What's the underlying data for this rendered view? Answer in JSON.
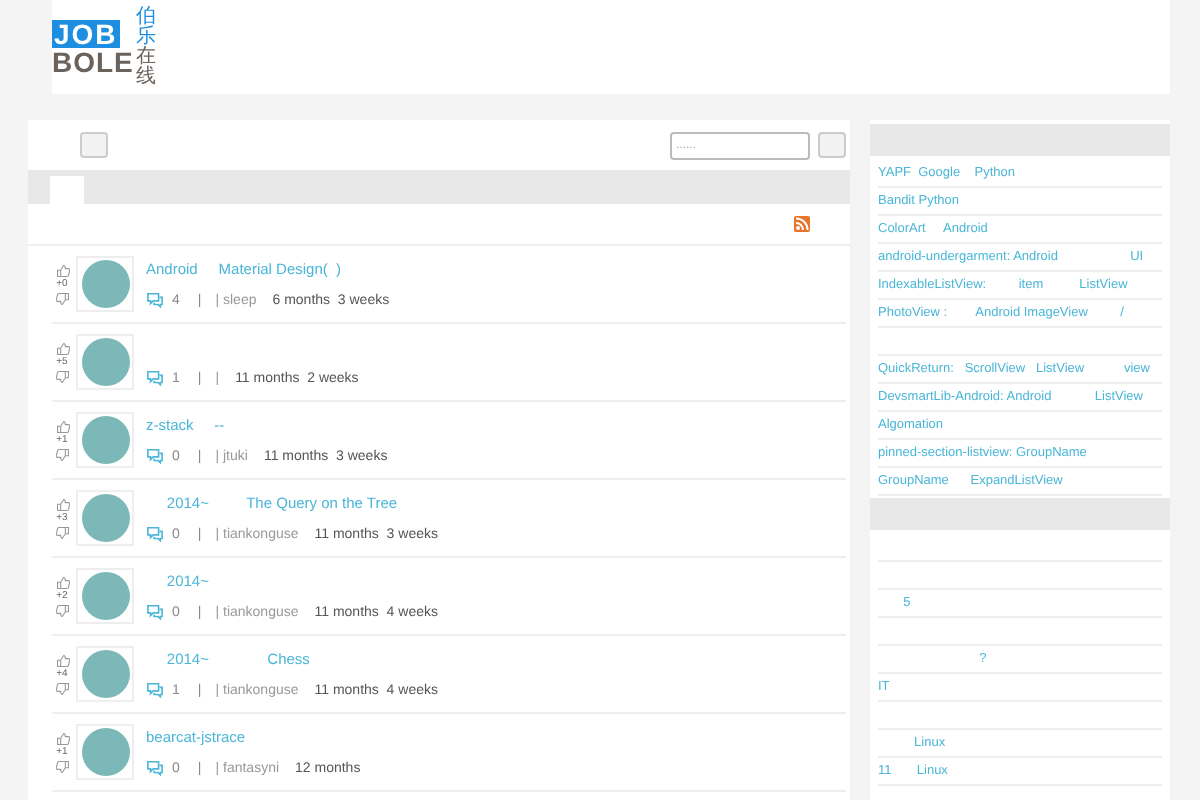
{
  "logo": {
    "top": "JOB",
    "bottom": "BOLE",
    "cjk_top": "伯乐",
    "cjk_bottom": "在线"
  },
  "search": {
    "placeholder": "......"
  },
  "tabs": [
    {
      "selected": true
    }
  ],
  "posts": [
    {
      "score": "+0",
      "title": "Android     Material Design(  )",
      "comments": "4",
      "separator": "|",
      "author": "| sleep",
      "time": "6 months  3 weeks"
    },
    {
      "score": "+5",
      "comments": "1",
      "separator": "|",
      "author": "|",
      "time": "11 months  2 weeks"
    },
    {
      "score": "+1",
      "title": "z-stack     --",
      "comments": "0",
      "separator": "|",
      "author": "| jtuki",
      "time": "11 months  3 weeks"
    },
    {
      "score": "+3",
      "title": "     2014~         The Query on the Tree",
      "comments": "0",
      "separator": "|",
      "author": "| tiankonguse",
      "time": "11 months  3 weeks"
    },
    {
      "score": "+2",
      "title": "     2014~",
      "comments": "0",
      "separator": "|",
      "author": "| tiankonguse",
      "time": "11 months  4 weeks"
    },
    {
      "score": "+4",
      "title": "     2014~              Chess",
      "comments": "1",
      "separator": "|",
      "author": "| tiankonguse",
      "time": "11 months  4 weeks"
    },
    {
      "score": "+1",
      "title": "bearcat-jstrace",
      "comments": "0",
      "separator": "|",
      "author": "| fantasyni",
      "time": "12 months"
    }
  ],
  "sidebar": {
    "links": [
      {
        "kind": "text",
        "text": "YAPF  Google    Python"
      },
      {
        "kind": "text",
        "text": "Bandit Python"
      },
      {
        "kind": "text",
        "text": "ColorArt     Android"
      },
      {
        "kind": "text",
        "text": "android-undergarment: Android                    UI"
      },
      {
        "kind": "text",
        "text": "IndexableListView:         item          ListView"
      },
      {
        "kind": "text",
        "text": "PhotoView :        Android ImageView         /"
      },
      {
        "kind": "blank"
      },
      {
        "kind": "text",
        "text": "QuickReturn:   ScrollView   ListView           view"
      },
      {
        "kind": "text",
        "text": "DevsmartLib-Android: Android            ListView"
      },
      {
        "kind": "text",
        "text": "Algomation"
      },
      {
        "kind": "text",
        "text": "pinned-section-listview: GroupName"
      },
      {
        "kind": "text",
        "text": "GroupName      ExpandListView"
      }
    ],
    "list": [
      {
        "kind": "blank"
      },
      {
        "kind": "blank"
      },
      {
        "kind": "text",
        "text": "       5"
      },
      {
        "kind": "blank"
      },
      {
        "kind": "text",
        "text": "                            ?"
      },
      {
        "kind": "text",
        "text": "IT"
      },
      {
        "kind": "blank"
      },
      {
        "kind": "text",
        "text": "          Linux"
      },
      {
        "kind": "text",
        "text": "11       Linux"
      }
    ]
  }
}
